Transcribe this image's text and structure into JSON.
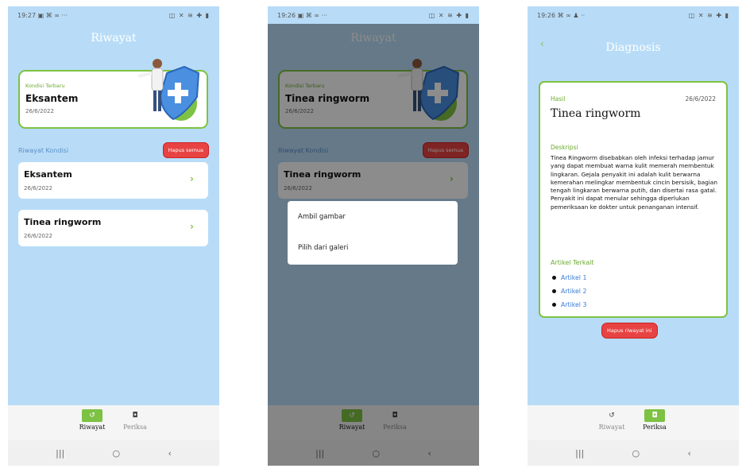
{
  "screen1": {
    "status_time": "19:27",
    "status_left_icons": "▣ ⌘ ∞ ···",
    "status_right_icons": "◫ ✕ ≋ ✚ ▮",
    "title": "Riwayat",
    "latest": {
      "label": "Kondisi Terbaru",
      "name": "Eksantem",
      "date": "26/6/2022"
    },
    "section_title": "Riwayat Kondisi",
    "clear_all": "Hapus semua",
    "items": [
      {
        "name": "Eksantem",
        "date": "26/6/2022"
      },
      {
        "name": "Tinea ringworm",
        "date": "26/6/2022"
      }
    ],
    "nav": {
      "riwayat": "Riwayat",
      "periksa": "Periksa",
      "active": "riwayat"
    }
  },
  "screen2": {
    "status_time": "19:26",
    "status_left_icons": "▣ ⌘ ∞ ···",
    "status_right_icons": "◫ ✕ ≋ ✚ ▮",
    "title": "Riwayat",
    "latest": {
      "label": "Kondisi Terbaru",
      "name": "Tinea ringworm",
      "date": "26/6/2022"
    },
    "section_title": "Riwayat Kondisi",
    "clear_all": "Hapus semua",
    "items": [
      {
        "name": "Tinea ringworm",
        "date": "26/6/2022"
      }
    ],
    "dialog": {
      "take_photo": "Ambil gambar",
      "from_gallery": "Pilih dari galeri"
    },
    "nav": {
      "riwayat": "Riwayat",
      "periksa": "Periksa",
      "active": "riwayat"
    }
  },
  "screen3": {
    "status_time": "19:26",
    "status_left_icons": "⌘ ∞ ♟ ··",
    "status_right_icons": "◫ ✕ ≋ ✚ ▮",
    "title": "Diagnosis",
    "hasil_label": "Hasil",
    "date": "26/6/2022",
    "name": "Tinea ringworm",
    "desc_label": "Deskripsi",
    "description": "Tinea Ringworm disebabkan oleh infeksi terhadap jamur yang dapat membuat warna kulit memerah membentuk lingkaran. Gejala penyakit ini adalah kulit berwarna kemerahan melingkar membentuk cincin bersisik, bagian tengah lingkaran berwarna putih, dan disertai rasa gatal. Penyakit ini dapat menular sehingga diperlukan pemeriksaan ke dokter untuk penanganan intensif.",
    "articles_label": "Artikel Terkait",
    "articles": [
      "Artikel 1",
      "Artikel 2",
      "Artikel 3"
    ],
    "delete": "Hapus riwayat ini",
    "nav": {
      "riwayat": "Riwayat",
      "periksa": "Periksa",
      "active": "periksa"
    }
  },
  "colors": {
    "background": "#b8dcf7",
    "accent_green": "#7dc243",
    "danger_red": "#e84343",
    "link_blue": "#3a7bd5"
  },
  "icons": {
    "riwayat": "history-icon",
    "periksa": "camera-icon",
    "back": "back-arrow-icon",
    "chevron": "chevron-right-icon"
  }
}
